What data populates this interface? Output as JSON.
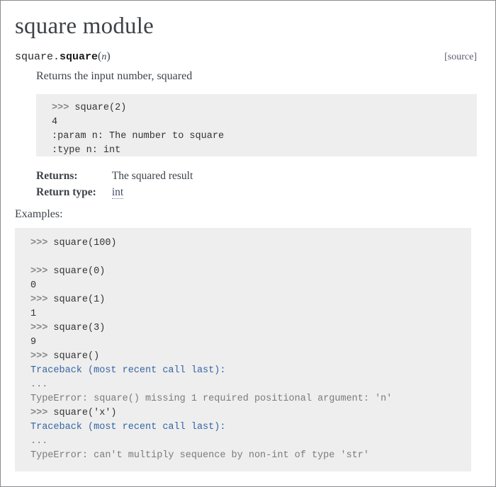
{
  "page": {
    "title": "square module",
    "frame_border_color": "#8d8a91",
    "background": "#ffffff",
    "text_color": "#3e4349"
  },
  "signature": {
    "prename": "square.",
    "name": "square",
    "open_paren": "(",
    "param": "n",
    "close_paren": ")",
    "source_label": "[source]"
  },
  "description": "Returns the input number, squared",
  "doctest_block": {
    "background": "#eeeeee",
    "lines": [
      {
        "prompt": ">>> ",
        "code": "square(2)",
        "kind": "input"
      },
      {
        "prompt": "",
        "code": "4",
        "kind": "output"
      },
      {
        "prompt": "",
        "code": ":param n: The number to square",
        "kind": "output"
      },
      {
        "prompt": "",
        "code": ":type n: int",
        "kind": "output"
      }
    ],
    "text": ">>> square(2)\n4\n:param n: The number to square\n:type n: int"
  },
  "fields": [
    {
      "name": "Returns:",
      "value": "The squared result",
      "is_xref": false
    },
    {
      "name": "Return type:",
      "value": "int",
      "is_xref": true
    }
  ],
  "examples": {
    "label": "Examples:",
    "background": "#eeeeee",
    "traceback_color": "#3465a4",
    "prompt_color": "#888888",
    "lines": [
      {
        "kind": "input",
        "prompt": ">>> ",
        "code": "square(100)"
      },
      {
        "kind": "blank",
        "prompt": "",
        "code": ""
      },
      {
        "kind": "input",
        "prompt": ">>> ",
        "code": "square(0)"
      },
      {
        "kind": "output",
        "prompt": "",
        "code": "0"
      },
      {
        "kind": "input",
        "prompt": ">>> ",
        "code": "square(1)"
      },
      {
        "kind": "output",
        "prompt": "",
        "code": "1"
      },
      {
        "kind": "input",
        "prompt": ">>> ",
        "code": "square(3)"
      },
      {
        "kind": "output",
        "prompt": "",
        "code": "9"
      },
      {
        "kind": "input",
        "prompt": ">>> ",
        "code": "square()"
      },
      {
        "kind": "traceback",
        "prompt": "",
        "code": "Traceback (most recent call last):"
      },
      {
        "kind": "dim",
        "prompt": "",
        "code": "..."
      },
      {
        "kind": "dim",
        "prompt": "",
        "code": "TypeError: square() missing 1 required positional argument: 'n'"
      },
      {
        "kind": "input",
        "prompt": ">>> ",
        "code": "square('x')"
      },
      {
        "kind": "traceback",
        "prompt": "",
        "code": "Traceback (most recent call last):"
      },
      {
        "kind": "dim",
        "prompt": "",
        "code": "..."
      },
      {
        "kind": "dim",
        "prompt": "",
        "code": "TypeError: can't multiply sequence by non-int of type 'str'"
      }
    ]
  }
}
